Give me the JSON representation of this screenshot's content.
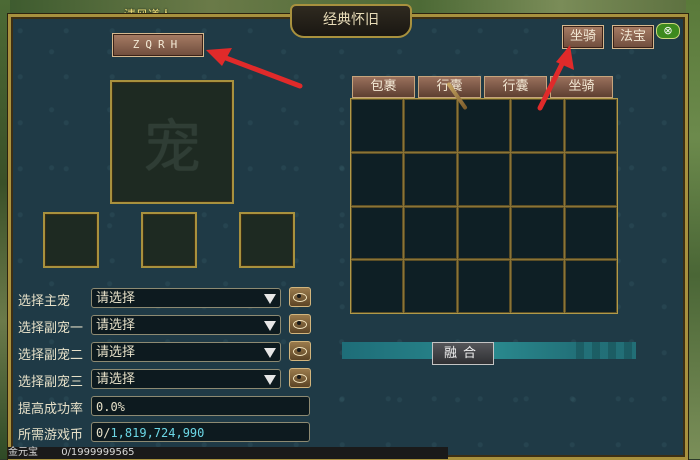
{
  "window": {
    "title": "经典怀旧",
    "character_name": "清风道人"
  },
  "buttons": {
    "code": "ZQRH",
    "mount": "坐骑",
    "treasure": "法宝",
    "merge": "融合",
    "close": "⊗"
  },
  "tabs": [
    {
      "label": "包裹"
    },
    {
      "label": "行囊"
    },
    {
      "label": "行囊"
    },
    {
      "label": "坐骑"
    }
  ],
  "pet_slot": {
    "glyph": "宠"
  },
  "selectors": [
    {
      "label": "选择主宠",
      "value": "请选择"
    },
    {
      "label": "选择副宠一",
      "value": "请选择"
    },
    {
      "label": "选择副宠二",
      "value": "请选择"
    },
    {
      "label": "选择副宠三",
      "value": "请选择"
    }
  ],
  "success_rate": {
    "label": "提高成功率",
    "value": "0.0%"
  },
  "currency": {
    "label": "所需游戏币",
    "current": "0/",
    "required": "1,819,724,990"
  },
  "bottom_bar": {
    "left": "金元宝",
    "value": "0/1999999565"
  },
  "colors": {
    "accent_gold": "#a8913e",
    "panel": "#1f3a46",
    "arrow": "#e02a2a",
    "currency_cyan": "#6cd7e6"
  },
  "icons": [
    "eye-icon",
    "chevron-down-icon",
    "close-icon"
  ]
}
